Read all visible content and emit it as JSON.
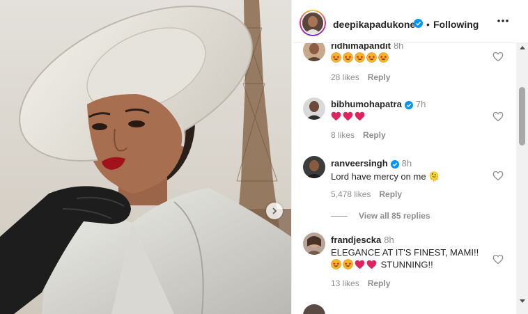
{
  "post": {
    "author": "deepikapadukone",
    "dot": "•",
    "follow_status": "Following",
    "more_icon": "more-horizontal-icon",
    "next_icon": "chevron-right-icon"
  },
  "comments": [
    {
      "username": "ridhimapandit",
      "time": "8h",
      "emojis": [
        "star-struck",
        "star-struck",
        "star-struck",
        "star-struck",
        "star-struck"
      ],
      "likes": "28 likes",
      "reply": "Reply"
    },
    {
      "username": "bibhumohapatra",
      "time": "7h",
      "verified": true,
      "emojis": [
        "red-heart",
        "red-heart",
        "red-heart"
      ],
      "likes": "8 likes",
      "reply": "Reply"
    },
    {
      "username": "ranveersingh",
      "time": "8h",
      "verified": true,
      "text": "Lord have mercy on me 🫠",
      "likes": "5,478 likes",
      "reply": "Reply"
    },
    {
      "username": "frandjescka",
      "time": "8h",
      "text": "ELEGANCE AT IT'S FINEST, MAMI!!",
      "text2": "STUNNING!!",
      "emojis": [
        "star-struck",
        "star-struck",
        "red-heart",
        "red-heart"
      ],
      "likes": "13 likes",
      "reply": "Reply"
    }
  ],
  "view_replies": "View all 85 replies",
  "colors": {
    "verified": "#0095f6",
    "secondary_text": "#8e8e8e",
    "primary_text": "#262626",
    "heart_red": "#e0245e"
  }
}
